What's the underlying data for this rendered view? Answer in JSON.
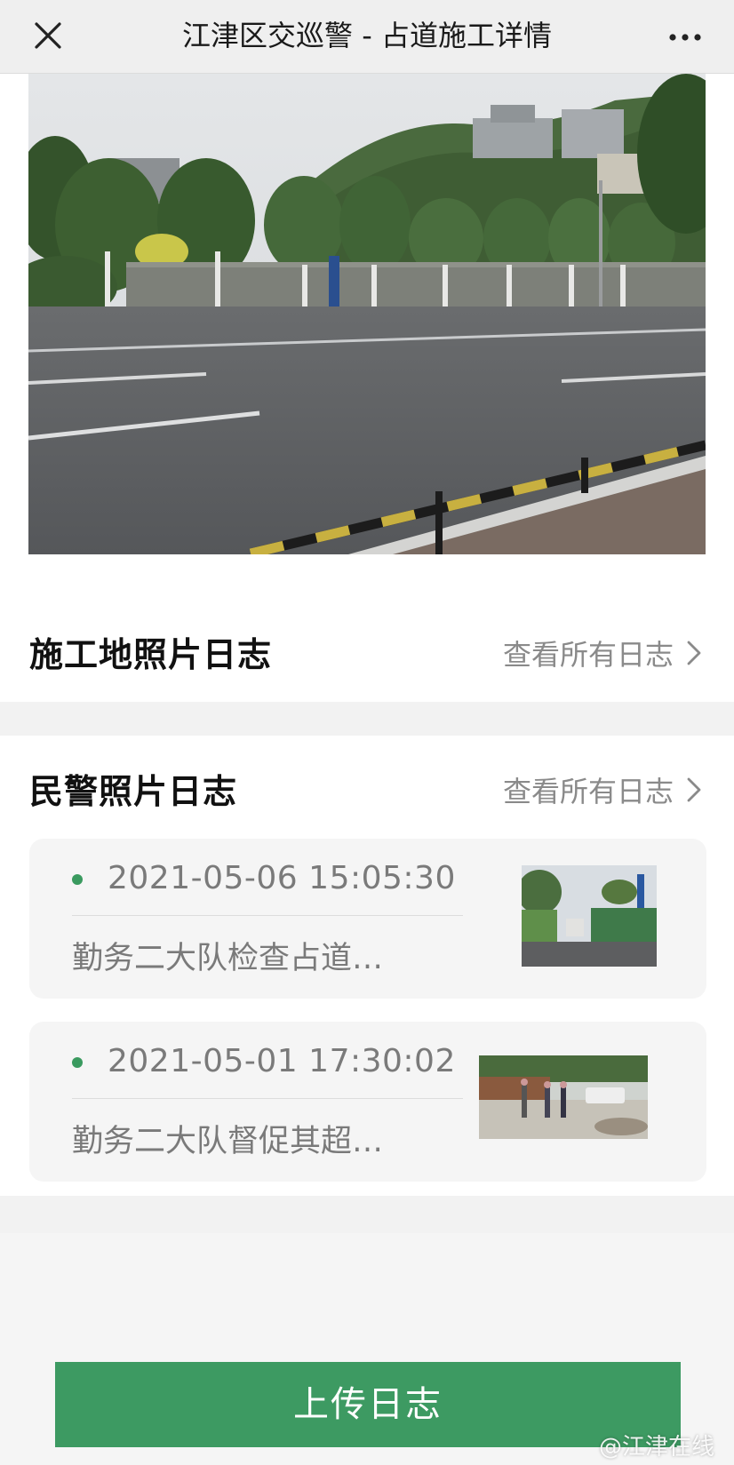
{
  "header": {
    "title": "江津区交巡警 - 占道施工详情",
    "close_icon": "close-icon",
    "more_icon": "more-icon"
  },
  "site_photo_log": {
    "title": "施工地照片日志",
    "view_all": "查看所有日志"
  },
  "police_photo_log": {
    "title": "民警照片日志",
    "view_all": "查看所有日志",
    "entries": [
      {
        "time": "2021-05-06 15:05:30",
        "desc": "勤务二大队检查占道…"
      },
      {
        "time": "2021-05-01 17:30:02",
        "desc": "勤务二大队督促其超…"
      }
    ]
  },
  "upload_button": "上传日志",
  "watermark": "@江津在线",
  "colors": {
    "accent": "#3d9a62",
    "status_dot": "#3a9a5f"
  }
}
